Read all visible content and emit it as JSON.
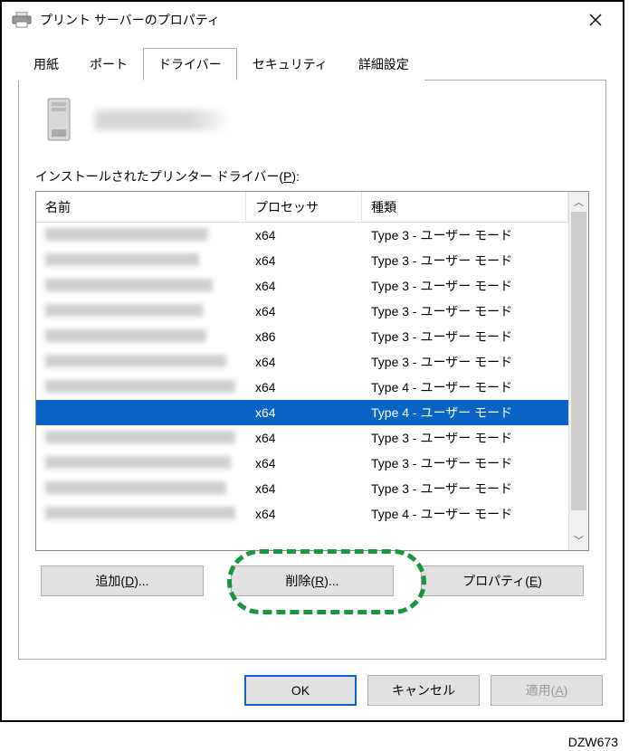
{
  "window": {
    "title": "プリント サーバーのプロパティ"
  },
  "tabs": {
    "paper": "用紙",
    "port": "ポート",
    "driver": "ドライバー",
    "security": "セキュリティ",
    "advanced": "詳細設定"
  },
  "list": {
    "label_prefix": "インストールされたプリンター ドライバー(",
    "label_hotkey": "P",
    "label_suffix": "):",
    "headers": {
      "name": "名前",
      "processor": "プロセッサ",
      "type": "種類"
    },
    "rows": [
      {
        "processor": "x64",
        "type": "Type 3 - ユーザー モード",
        "selected": false,
        "nw": 180
      },
      {
        "processor": "x64",
        "type": "Type 3 - ユーザー モード",
        "selected": false,
        "nw": 170
      },
      {
        "processor": "x64",
        "type": "Type 3 - ユーザー モード",
        "selected": false,
        "nw": 185
      },
      {
        "processor": "x64",
        "type": "Type 3 - ユーザー モード",
        "selected": false,
        "nw": 175
      },
      {
        "processor": "x86",
        "type": "Type 3 - ユーザー モード",
        "selected": false,
        "nw": 178
      },
      {
        "processor": "x64",
        "type": "Type 3 - ユーザー モード",
        "selected": false,
        "nw": 200
      },
      {
        "processor": "x64",
        "type": "Type 4 - ユーザー モード",
        "selected": false,
        "nw": 210
      },
      {
        "processor": "x64",
        "type": "Type 4 - ユーザー モード",
        "selected": true,
        "nw": 0
      },
      {
        "processor": "x64",
        "type": "Type 3 - ユーザー モード",
        "selected": false,
        "nw": 210
      },
      {
        "processor": "x64",
        "type": "Type 3 - ユーザー モード",
        "selected": false,
        "nw": 205
      },
      {
        "processor": "x64",
        "type": "Type 3 - ユーザー モード",
        "selected": false,
        "nw": 200
      },
      {
        "processor": "x64",
        "type": "Type 4 - ユーザー モード",
        "selected": false,
        "nw": 210
      }
    ]
  },
  "buttons": {
    "add": "追加(D)...",
    "remove": "削除(R)...",
    "properties": "プロパティ(E)",
    "ok": "OK",
    "cancel": "キャンセル",
    "apply": "適用(A)"
  },
  "image_id": "DZW673"
}
